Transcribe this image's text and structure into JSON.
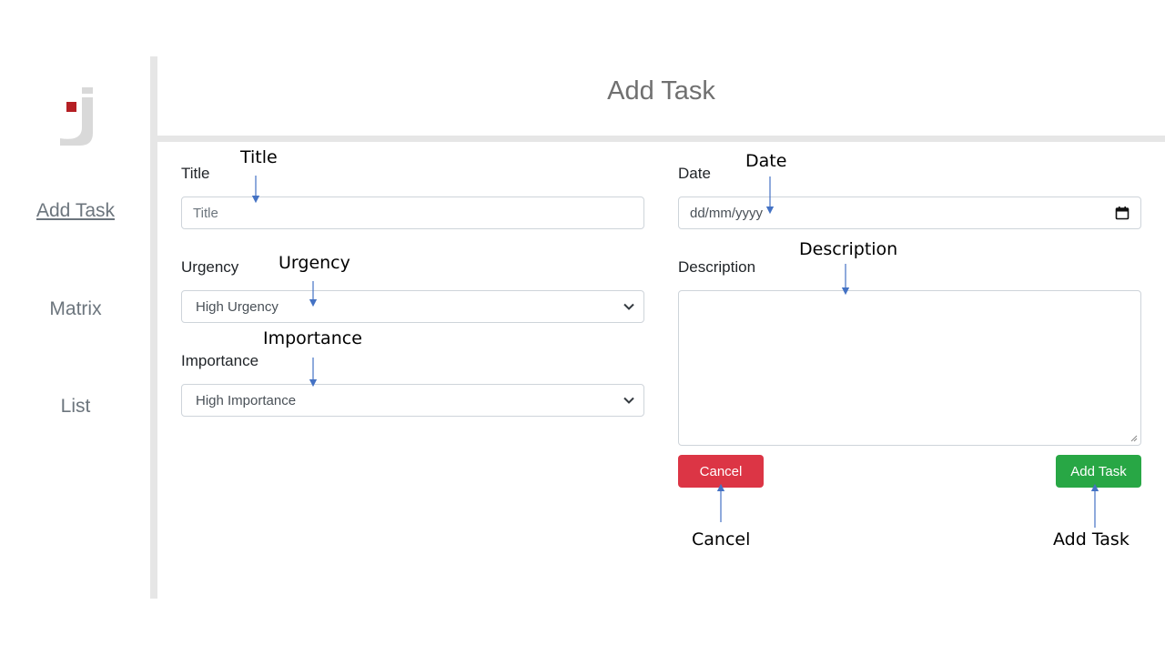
{
  "header": {
    "title": "Add Task"
  },
  "sidebar": {
    "items": [
      {
        "label": "Add Task",
        "active": true
      },
      {
        "label": "Matrix",
        "active": false
      },
      {
        "label": "List",
        "active": false
      }
    ]
  },
  "form": {
    "title": {
      "label": "Title",
      "placeholder": "Title",
      "value": ""
    },
    "urgency": {
      "label": "Urgency",
      "selected": "High Urgency"
    },
    "importance": {
      "label": "Importance",
      "selected": "High Importance"
    },
    "date": {
      "label": "Date",
      "placeholder": "dd/mm/yyyy"
    },
    "description": {
      "label": "Description",
      "value": ""
    },
    "buttons": {
      "cancel": "Cancel",
      "add": "Add Task"
    }
  },
  "annotations": {
    "title": "Title",
    "urgency": "Urgency",
    "importance": "Importance",
    "date": "Date",
    "description": "Description",
    "cancel": "Cancel",
    "add_task": "Add Task"
  },
  "colors": {
    "cancel": "#dc3545",
    "add": "#28a745",
    "logo_accent": "#b51f24",
    "arrow": "#4472c4"
  },
  "icons": {
    "logo": "j-logo",
    "date": "calendar-icon",
    "select": "chevron-down-icon"
  }
}
